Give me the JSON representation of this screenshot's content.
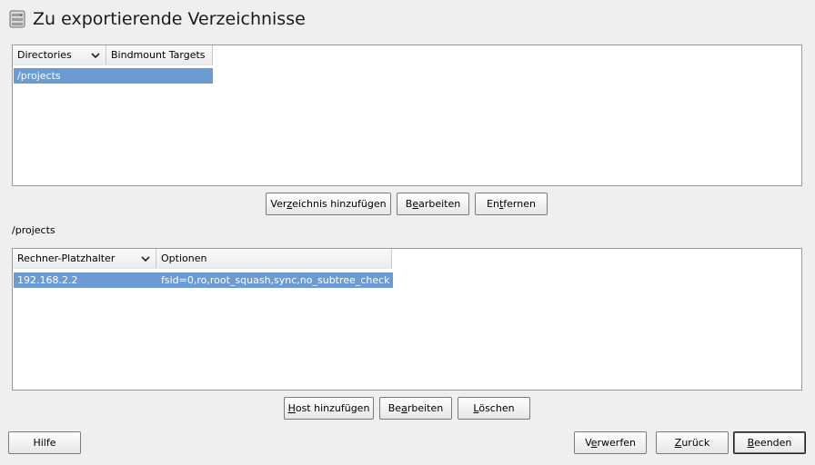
{
  "title": "Zu exportierende Verzeichnisse",
  "directories_table": {
    "columns": [
      "Directories",
      "Bindmount Targets"
    ],
    "rows": [
      {
        "directory": "/projects",
        "bindmount": ""
      }
    ]
  },
  "directory_buttons": {
    "add": {
      "pre": "Ver",
      "mn": "z",
      "post": "eichnis hinzufügen"
    },
    "edit": {
      "pre": "B",
      "mn": "e",
      "post": "arbeiten"
    },
    "remove": {
      "pre": "En",
      "mn": "t",
      "post": "fernen"
    }
  },
  "selected_directory_label": "/projects",
  "hosts_table": {
    "columns": [
      "Rechner-Platzhalter",
      "Optionen"
    ],
    "rows": [
      {
        "host": "192.168.2.2",
        "options": "fsid=0,ro,root_squash,sync,no_subtree_check"
      }
    ]
  },
  "host_buttons": {
    "add": {
      "pre": "",
      "mn": "H",
      "post": "ost hinzufügen"
    },
    "edit": {
      "pre": "Be",
      "mn": "a",
      "post": "rbeiten"
    },
    "delete": {
      "pre": "",
      "mn": "L",
      "post": "öschen"
    }
  },
  "footer": {
    "help": "Hilfe",
    "discard": {
      "pre": "V",
      "mn": "e",
      "post": "rwerfen"
    },
    "back": {
      "pre": "",
      "mn": "Z",
      "post": "urück"
    },
    "finish": {
      "pre": "",
      "mn": "B",
      "post": "eenden"
    }
  },
  "colors": {
    "selection": "#6b9bd2",
    "background": "#efefef"
  },
  "icons": {
    "title": "nfs-server-icon",
    "column_sort": "chevron-down-icon"
  }
}
